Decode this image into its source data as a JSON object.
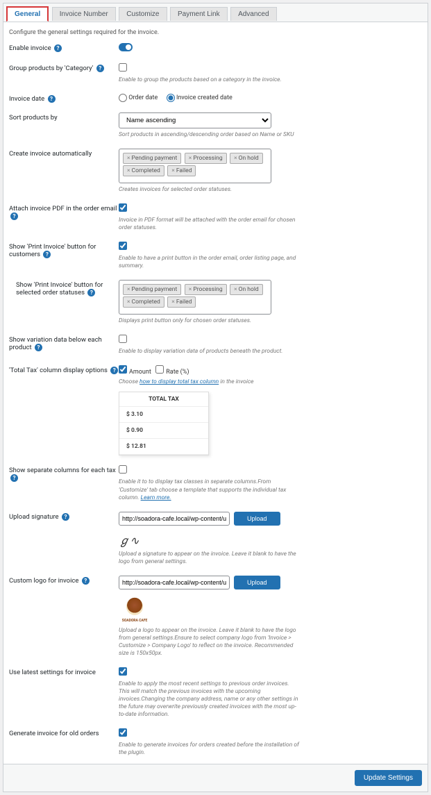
{
  "tabs": [
    "General",
    "Invoice Number",
    "Customize",
    "Payment Link",
    "Advanced"
  ],
  "intro": "Configure the general settings required for the invoice.",
  "rows": {
    "enable": {
      "label": "Enable invoice"
    },
    "group": {
      "label": "Group products by 'Category'",
      "desc": "Enable to group the products based on a category in the invoice."
    },
    "invoice_date": {
      "label": "Invoice date",
      "order": "Order date",
      "created": "Invoice created date"
    },
    "sort": {
      "label": "Sort products by",
      "value": "Name ascending",
      "desc": "Sort products in ascending/descending order based on Name or SKU"
    },
    "auto": {
      "label": "Create invoice automatically",
      "chips": [
        "Pending payment",
        "Processing",
        "On hold",
        "Completed",
        "Failed"
      ],
      "desc": "Creates invoices for selected order statuses."
    },
    "attach_pdf": {
      "label": "Attach invoice PDF in the order email",
      "desc": "Invoice in PDF format will be attached with the order email for chosen order statuses."
    },
    "show_print": {
      "label": "Show 'Print Invoice' button for customers",
      "desc": "Enable to have a print button in the order email, order listing page, and summary."
    },
    "print_statuses": {
      "label": "Show 'Print Invoice' button for selected order statuses",
      "chips": [
        "Pending payment",
        "Processing",
        "On hold",
        "Completed",
        "Failed"
      ],
      "desc": "Displays print button only for chosen order statuses."
    },
    "variation": {
      "label": "Show variation data below each product",
      "desc": "Enable to display variation data of products beneath the product."
    },
    "total_tax": {
      "label": "'Total Tax' column display options",
      "amount": "Amount",
      "rate": "Rate (%)",
      "desc_pre": "Choose ",
      "desc_link": "how to display total tax column",
      "desc_post": " in the invoice",
      "table_header": "TOTAL TAX",
      "vals": [
        "$ 3.10",
        "$ 0.90",
        "$ 12.81"
      ]
    },
    "sep_cols": {
      "label": "Show separate columns for each tax",
      "desc": "Enable it to to display tax classes in separate columns.From 'Customize' tab choose a template that supports the individual tax column. ",
      "link": "Learn more."
    },
    "sig": {
      "label": "Upload signature",
      "value": "http://soadora-cafe.local/wp-content/up",
      "btn": "Upload",
      "desc": "Upload a signature to appear on the invoice. Leave it blank to have the logo from general settings."
    },
    "logo": {
      "label": "Custom logo for invoice",
      "value": "http://soadora-cafe.local/wp-content/up",
      "btn": "Upload",
      "logo_text": "SOADORA CAFE",
      "desc": "Upload a logo to appear on the invoice. Leave it blank to have the logo from general settings.Ensure to select company logo from 'Invoice > Customize > Company Logo' to reflect on the invoice. Recommended size is 150x50px."
    },
    "latest": {
      "label": "Use latest settings for invoice",
      "desc": "Enable to apply the most recent settings to previous order invoices. This will match the previous invoices with the upcoming invoices.Changing the company address, name or any other settings in the future may overwrite previously created invoices with the most up-to-date information."
    },
    "old": {
      "label": "Generate invoice for old orders",
      "desc": "Enable to generate invoices for orders created before the installation of the plugin."
    }
  },
  "footer": {
    "button": "Update Settings"
  }
}
